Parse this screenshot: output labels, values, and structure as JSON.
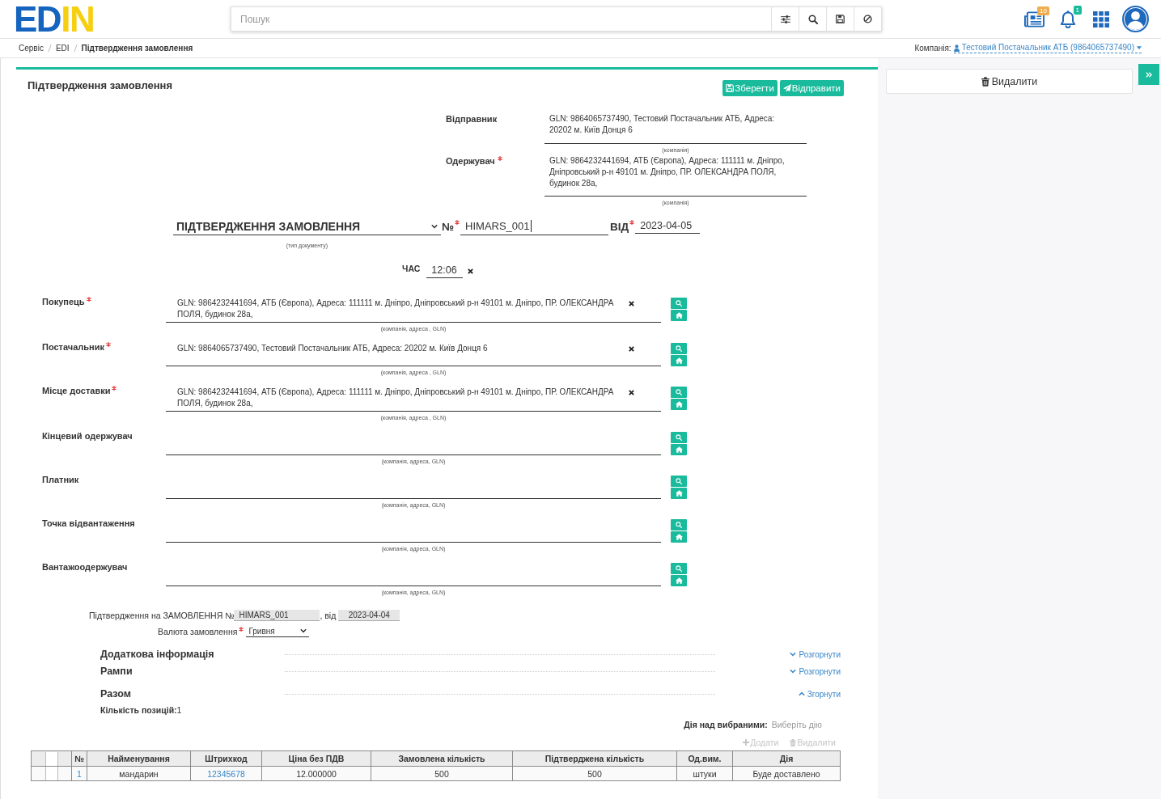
{
  "header": {
    "logo": "EDIN",
    "search": {
      "placeholder": "Пошук"
    },
    "notifications": [
      {
        "kind": "news",
        "badge": "10",
        "color": "#f0ad4e"
      },
      {
        "kind": "bell",
        "badge": "1",
        "color": "#1abb9c"
      }
    ]
  },
  "breadcrumbs": [
    {
      "label": "Сервіс",
      "current": false
    },
    {
      "label": "EDI",
      "current": false
    },
    {
      "label": "Підтвердження замовлення",
      "current": true
    }
  ],
  "company": {
    "label": "Компанія:",
    "value": "Тестовий Постачальник АТБ (9864065737490)"
  },
  "document": {
    "title": "Підтвердження замовлення",
    "actions": [
      {
        "kind": "save",
        "label": "Зберегти"
      },
      {
        "kind": "send",
        "label": "Відправити"
      }
    ],
    "correspondents": [
      {
        "label": "Відправник",
        "required": false,
        "value": "GLN: 9864065737490, Тестовий Постачальник АТБ, Адреса: 20202 м. Київ Донця 6",
        "caption": "(компанія)"
      },
      {
        "label": "Одержувач",
        "required": true,
        "value": "GLN: 9864232441694, АТБ (Європа), Адреса: 111111 м. Дніпро, Дніпровський р-н 49101 м. Дніпро, ПР. ОЛЕКСАНДРА ПОЛЯ, будинок 28а,",
        "caption": "(компанія)"
      }
    ],
    "doc_type": {
      "value": "ПІДТВЕРДЖЕННЯ ЗАМОВЛЕННЯ",
      "caption": "(тип документу)"
    },
    "number": {
      "label": "№",
      "required": true,
      "value": "HIMARS_001",
      "focused": true
    },
    "date": {
      "label": "ВІД",
      "required": true,
      "value": "2023-04-05"
    },
    "time": {
      "label": "ЧАС",
      "value": "12:06"
    },
    "parties": [
      {
        "label": "Покупець",
        "required": true,
        "value": "GLN: 9864232441694, АТБ (Європа), Адреса: 111111 м. Дніпро, Дніпровський р-н 49101 м. Дніпро, ПР. ОЛЕКСАНДРА ПОЛЯ, будинок 28а,",
        "caption": "(компанія, адреса , GLN)"
      },
      {
        "label": "Постачальник",
        "required": true,
        "value": "GLN: 9864065737490, Тестовий Постачальник АТБ, Адреса: 20202 м. Київ Донця 6",
        "caption": "(компанія, адреса , GLN)"
      },
      {
        "label": "Місце доставки",
        "required": true,
        "value": "GLN: 9864232441694, АТБ (Європа), Адреса: 111111 м. Дніпро, Дніпровський р-н 49101 м. Дніпро, ПР. ОЛЕКСАНДРА ПОЛЯ, будинок 28а,",
        "caption": "(компанія, адреса , GLN)"
      },
      {
        "label": "Кінцевий одержувач",
        "required": false,
        "caption": "(компанія, адреса, GLN)"
      },
      {
        "label": "Платник",
        "required": false,
        "caption": "(компанія, адреса, GLN)"
      },
      {
        "label": "Точка відвантаження",
        "required": false,
        "caption": "(компанія, адреса, GLN)"
      },
      {
        "label": "Вантажоодержувач",
        "required": false,
        "caption": "(компанія, адреса, GLN)"
      }
    ],
    "order_ref": {
      "label": "Підтвердження на ЗАМОВЛЕННЯ №",
      "number": "HIMARS_001",
      "date_label": ", від",
      "date": "2023-04-04"
    },
    "currency": {
      "label": "Валюта замовлення",
      "required": true,
      "value": "Гривня"
    },
    "sections": [
      {
        "title": "Додаткова інформація",
        "expanded": false,
        "toggle": "Розгорнути"
      },
      {
        "title": "Рампи",
        "expanded": false,
        "toggle": "Розгорнути"
      },
      {
        "title": "Разом",
        "expanded": true,
        "toggle": "Згорнути",
        "items": [
          {
            "label": "Кількість позицій:",
            "value": "1"
          }
        ]
      }
    ],
    "bulk_action": {
      "label": "Дія над вибраними:",
      "placeholder": "Виберіть дію"
    },
    "row_actions": [
      {
        "kind": "add",
        "label": "Додати",
        "disabled": true
      },
      {
        "kind": "delete",
        "label": "Видалити",
        "disabled": true
      }
    ],
    "table": {
      "select_all_checked": false,
      "columns": [
        {
          "label": "№",
          "kind": "link"
        },
        {
          "label": "Найменування",
          "kind": "text"
        },
        {
          "label": "Штрихкод",
          "kind": "link"
        },
        {
          "label": "Ціна без ПДВ",
          "kind": "text"
        },
        {
          "label": "Замовлена кількість",
          "kind": "text"
        },
        {
          "label": "Підтверджена кількість",
          "kind": "text"
        },
        {
          "label": "Од.вим.",
          "kind": "text"
        },
        {
          "label": "Дія",
          "kind": "text"
        }
      ],
      "rows": [
        {
          "checked": false,
          "cells": [
            "1",
            "мандарин",
            "12345678",
            "12.000000",
            "500",
            "500",
            "штуки",
            "Буде доставлено"
          ]
        }
      ]
    }
  },
  "sidebar": {
    "actions": [
      {
        "kind": "delete",
        "label": "Видалити"
      }
    ]
  }
}
